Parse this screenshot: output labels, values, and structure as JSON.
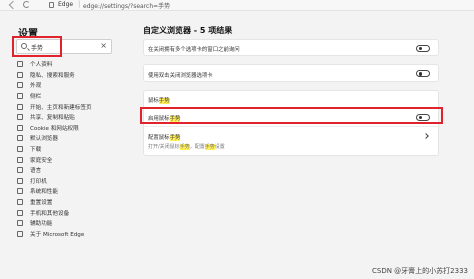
{
  "address_bar": {
    "site_label": "Edge",
    "url": "edge://settings/?search=手势"
  },
  "sidebar": {
    "title": "设置",
    "search": {
      "value": "手势",
      "clear": "×"
    },
    "items": [
      {
        "label": "个人资料",
        "icon": "profile-icon"
      },
      {
        "label": "隐私、搜索和服务",
        "icon": "lock-icon"
      },
      {
        "label": "外观",
        "icon": "appearance-icon"
      },
      {
        "label": "侧栏",
        "icon": "sidebar-icon"
      },
      {
        "label": "开始、主页和新建标签页",
        "icon": "home-icon"
      },
      {
        "label": "共享、复制和粘贴",
        "icon": "share-icon"
      },
      {
        "label": "Cookie 和网站权限",
        "icon": "cookie-icon"
      },
      {
        "label": "默认浏览器",
        "icon": "browser-icon"
      },
      {
        "label": "下载",
        "icon": "download-icon"
      },
      {
        "label": "家庭安全",
        "icon": "family-icon"
      },
      {
        "label": "语言",
        "icon": "language-icon"
      },
      {
        "label": "打印机",
        "icon": "printer-icon"
      },
      {
        "label": "系统和性能",
        "icon": "system-icon"
      },
      {
        "label": "重置设置",
        "icon": "reset-icon"
      },
      {
        "label": "手机和其他设备",
        "icon": "phone-icon"
      },
      {
        "label": "辅助功能",
        "icon": "accessibility-icon"
      },
      {
        "label": "关于 Microsoft Edge",
        "icon": "edge-icon"
      }
    ]
  },
  "main": {
    "heading": "自定义浏览器 - 5 项结果",
    "card1": {
      "label": "在关闭拥有多个选项卡的窗口之前询问"
    },
    "card2": {
      "label": "使用双击关闭浏览器选项卡"
    },
    "card3": {
      "section_prefix": "鼠标",
      "section_hl": "手势",
      "row1_prefix": "启用鼠标",
      "row1_hl": "手势",
      "row2_prefix": "配置鼠标",
      "row2_hl": "手势",
      "row2_sub_a": "打开/关闭鼠标",
      "row2_sub_hl1": "手势",
      "row2_sub_b": "，配置",
      "row2_sub_hl2": "手势",
      "row2_sub_c": "设置"
    }
  },
  "watermark": "CSDN @牙膏上的小苏打2333",
  "colors": {
    "highlight_box": "#e0232d",
    "search_highlight": "#ffee57"
  }
}
